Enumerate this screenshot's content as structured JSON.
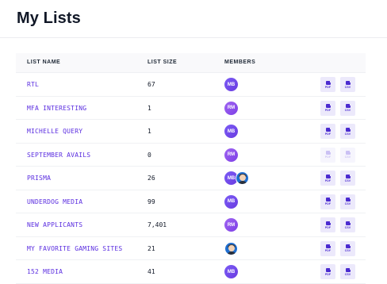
{
  "page": {
    "title": "My Lists"
  },
  "table": {
    "columns": {
      "name": "LIST NAME",
      "size": "LIST SIZE",
      "members": "MEMBERS"
    },
    "export_labels": {
      "pdf": "PDF",
      "csv": "CSV"
    },
    "rows": [
      {
        "name": "RTL",
        "size": "67",
        "members": [
          {
            "type": "initials",
            "text": "MB"
          }
        ],
        "downloads_enabled": true
      },
      {
        "name": "MFA INTERESTING",
        "size": "1",
        "members": [
          {
            "type": "initials",
            "text": "RM"
          }
        ],
        "downloads_enabled": true
      },
      {
        "name": "MICHELLE QUERY",
        "size": "1",
        "members": [
          {
            "type": "initials",
            "text": "MB"
          }
        ],
        "downloads_enabled": true
      },
      {
        "name": "SEPTEMBER AVAILS",
        "size": "0",
        "members": [
          {
            "type": "initials",
            "text": "RM"
          }
        ],
        "downloads_enabled": false
      },
      {
        "name": "PRISMA",
        "size": "26",
        "members": [
          {
            "type": "initials",
            "text": "MB"
          },
          {
            "type": "photo"
          }
        ],
        "downloads_enabled": true
      },
      {
        "name": "UNDERDOG MEDIA",
        "size": "99",
        "members": [
          {
            "type": "initials",
            "text": "MB"
          }
        ],
        "downloads_enabled": true
      },
      {
        "name": "NEW APPLICANTS",
        "size": "7,401",
        "members": [
          {
            "type": "initials",
            "text": "RM"
          }
        ],
        "downloads_enabled": true
      },
      {
        "name": "MY FAVORITE GAMING SITES",
        "size": "21",
        "members": [
          {
            "type": "photo"
          }
        ],
        "downloads_enabled": true
      },
      {
        "name": "152 MEDIA",
        "size": "41",
        "members": [
          {
            "type": "initials",
            "text": "MB"
          }
        ],
        "downloads_enabled": true
      }
    ]
  },
  "colors": {
    "accent": "#5b2ee0",
    "avatar_mb": "#6a3be0",
    "avatar_rm": "#8b4ce8",
    "button_bg": "#ece9fb"
  },
  "icons": {
    "pdf": "pdf-file-icon",
    "csv": "csv-file-icon"
  }
}
